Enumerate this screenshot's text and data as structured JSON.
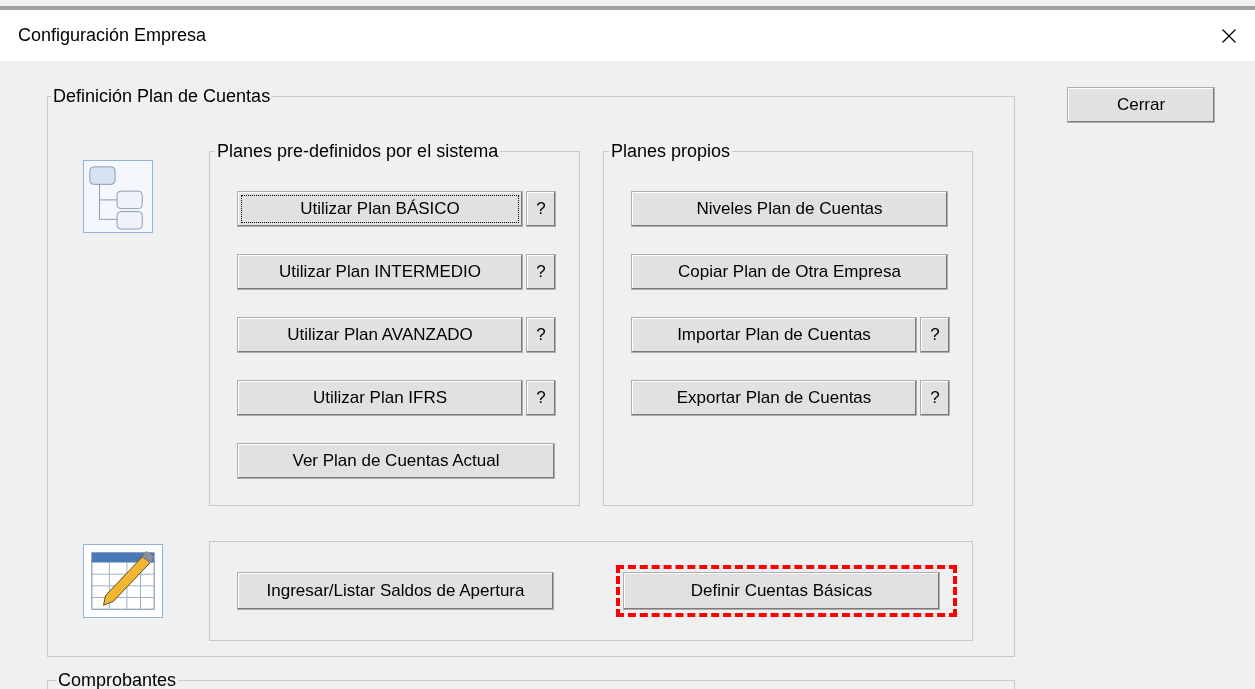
{
  "window": {
    "title": "Configuración Empresa"
  },
  "close_button": {
    "label": "Cerrar"
  },
  "plan_group": {
    "title": "Definición Plan de Cuentas",
    "predefined": {
      "title": "Planes pre-definidos por el sistema",
      "buttons": [
        {
          "label": "Utilizar Plan BÁSICO",
          "help": "?",
          "focused": true
        },
        {
          "label": "Utilizar Plan INTERMEDIO",
          "help": "?",
          "focused": false
        },
        {
          "label": "Utilizar Plan AVANZADO",
          "help": "?",
          "focused": false
        },
        {
          "label": "Utilizar Plan IFRS",
          "help": "?",
          "focused": false
        },
        {
          "label": "Ver Plan de Cuentas Actual",
          "focused": false
        }
      ]
    },
    "own": {
      "title": "Planes propios",
      "buttons": [
        {
          "label": "Niveles Plan de Cuentas"
        },
        {
          "label": "Copiar Plan de Otra Empresa"
        },
        {
          "label": "Importar Plan de Cuentas",
          "help": "?"
        },
        {
          "label": "Exportar Plan de Cuentas",
          "help": "?"
        }
      ]
    },
    "balances": {
      "buttons": [
        {
          "label": "Ingresar/Listar Saldos de Apertura",
          "highlighted": false
        },
        {
          "label": "Definir Cuentas Básicas",
          "highlighted": true
        }
      ]
    }
  },
  "vouchers_group": {
    "title": "Comprobantes"
  }
}
